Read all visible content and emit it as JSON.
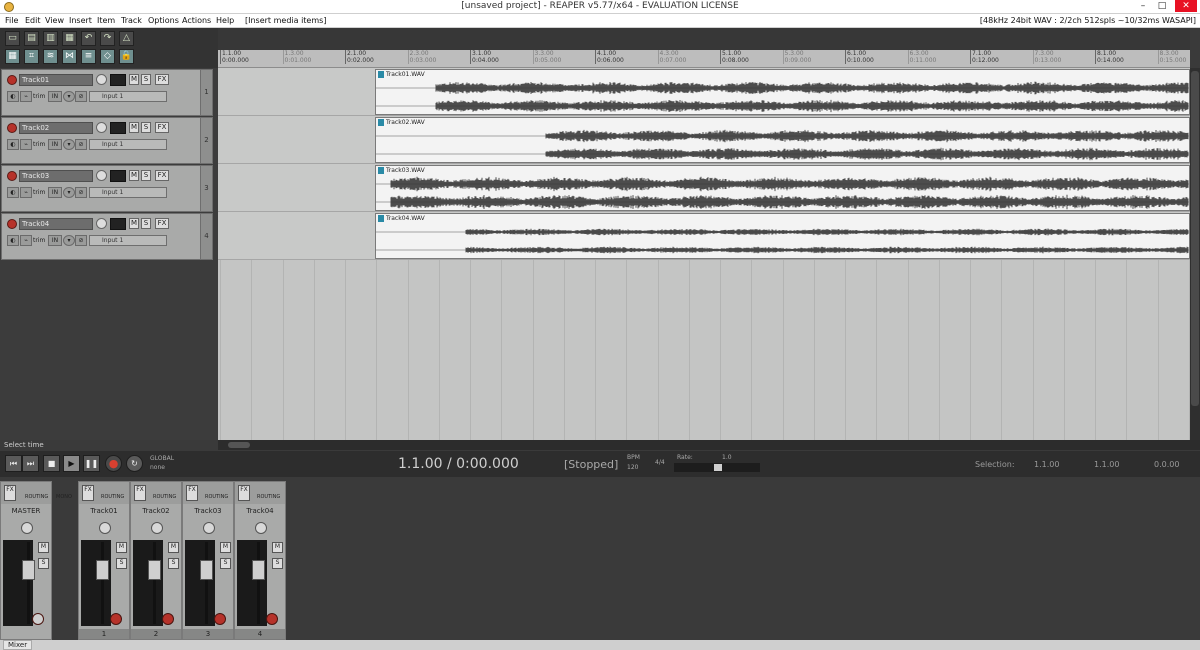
{
  "window": {
    "title": "[unsaved project] - REAPER v5.77/x64 - EVALUATION LICENSE",
    "minimize": "–",
    "maximize": "□",
    "close": "✕"
  },
  "menu": {
    "items": [
      "File",
      "Edit",
      "View",
      "Insert",
      "Item",
      "Track",
      "Options",
      "Actions",
      "Help",
      "[Insert media items]"
    ],
    "status": "[48kHz 24bit WAV : 2/2ch 512spls ~10/32ms WASAPI]"
  },
  "toolbar": {
    "icons": [
      "new-project",
      "open-project",
      "save-project",
      "project-settings",
      "undo",
      "redo",
      "metronome",
      "snap",
      "ripple-edit",
      "grid",
      "lock",
      "auto-crossfade",
      "envelopes"
    ]
  },
  "tracks": [
    {
      "name": "Track01",
      "number": "1",
      "trim": "trim",
      "input": "Input 1"
    },
    {
      "name": "Track02",
      "number": "2",
      "trim": "trim",
      "input": "Input 1"
    },
    {
      "name": "Track03",
      "number": "3",
      "trim": "trim",
      "input": "Input 1"
    },
    {
      "name": "Track04",
      "number": "4",
      "trim": "trim",
      "input": "Input 1"
    }
  ],
  "track_buttons": {
    "m": "M",
    "s": "S",
    "fx": "FX",
    "in": "IN"
  },
  "ruler": {
    "major": [
      {
        "bar": "1.1.00",
        "time": "0:00.000"
      },
      {
        "bar": "2.1.00",
        "time": "0:02.000"
      },
      {
        "bar": "3.1.00",
        "time": "0:04.000"
      },
      {
        "bar": "4.1.00",
        "time": "0:06.000"
      },
      {
        "bar": "5.1.00",
        "time": "0:08.000"
      },
      {
        "bar": "6.1.00",
        "time": "0:10.000"
      },
      {
        "bar": "7.1.00",
        "time": "0:12.000"
      },
      {
        "bar": "8.1.00",
        "time": "0:14.000"
      }
    ],
    "minor": [
      {
        "bar": "1.3.00",
        "time": "0:01.000"
      },
      {
        "bar": "2.3.00",
        "time": "0:03.000"
      },
      {
        "bar": "3.3.00",
        "time": "0:05.000"
      },
      {
        "bar": "4.3.00",
        "time": "0:07.000"
      },
      {
        "bar": "5.3.00",
        "time": "0:09.000"
      },
      {
        "bar": "6.3.00",
        "time": "0:11.000"
      },
      {
        "bar": "7.3.00",
        "time": "0:13.000"
      },
      {
        "bar": "8.3.00",
        "time": "0:15.000"
      }
    ]
  },
  "clips": [
    {
      "label": "Track01.WAV"
    },
    {
      "label": "Track02.WAV"
    },
    {
      "label": "Track03.WAV"
    },
    {
      "label": "Track04.WAV"
    }
  ],
  "transport": {
    "select_label": "Select time",
    "position": "1.1.00 / 0:00.000",
    "state": "[Stopped]",
    "bpm_label": "BPM",
    "bpm": "120",
    "time_sig": "4/4",
    "rate_label": "Rate:",
    "rate": "1.0",
    "global_label": "GLOBAL",
    "none_label": "none",
    "selection_label": "Selection:",
    "selection_start": "1.1.00",
    "selection_end": "1.1.00",
    "selection_length": "0.0.00"
  },
  "mixer": {
    "strips": [
      {
        "name": "MASTER",
        "number": "",
        "routing": "ROUTING",
        "mono": "MONO"
      },
      {
        "name": "Track01",
        "number": "1",
        "routing": "ROUTING"
      },
      {
        "name": "Track02",
        "number": "2",
        "routing": "ROUTING"
      },
      {
        "name": "Track03",
        "number": "3",
        "routing": "ROUTING"
      },
      {
        "name": "Track04",
        "number": "4",
        "routing": "ROUTING"
      }
    ],
    "db_scale": [
      "-inf",
      "-6-",
      "-18-",
      "-30-",
      "-42-",
      "-54-"
    ],
    "master_scale": [
      "12",
      "6",
      "0",
      "-6",
      "-12",
      "-18",
      "-24",
      "-30",
      "-36",
      "-42",
      "-48"
    ],
    "tab_label": "Mixer"
  },
  "colors": {
    "accent": "#2a8aa6",
    "record": "#b6322a",
    "background": "#3a3a3a"
  }
}
